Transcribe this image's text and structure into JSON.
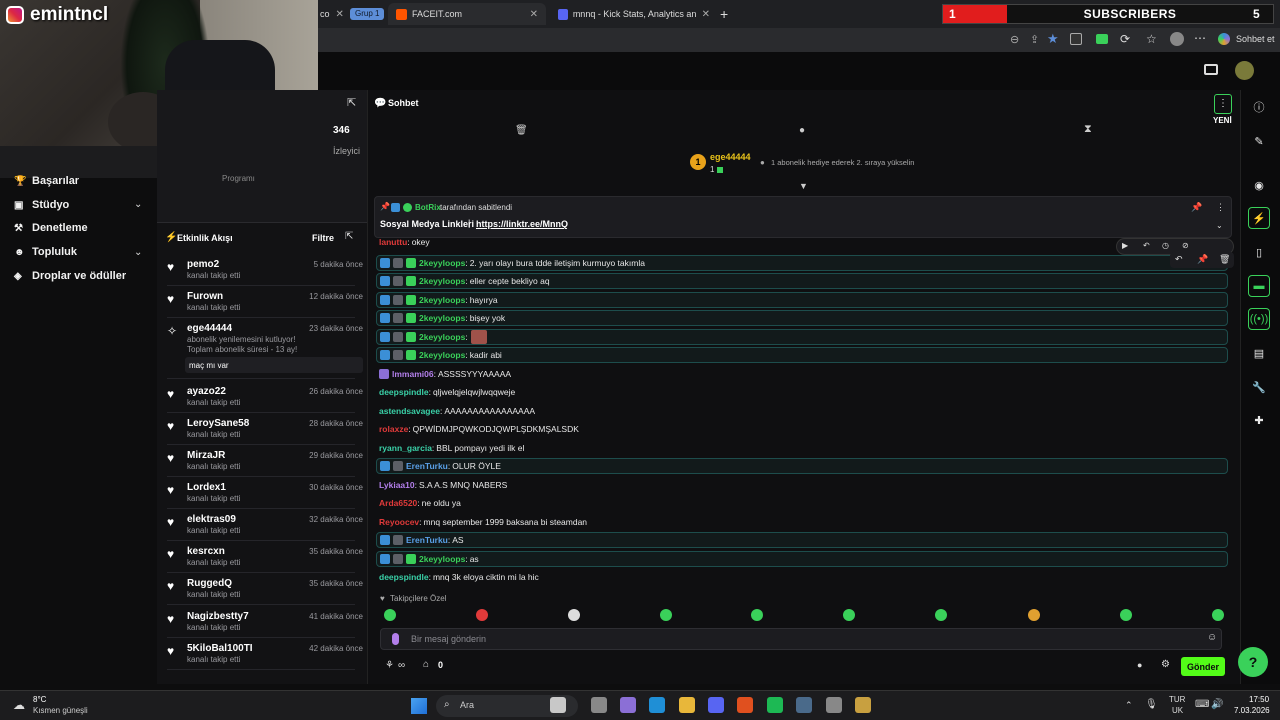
{
  "streamer": {
    "name": "emintncl"
  },
  "subs_bar": {
    "count": "1",
    "label": "SUBSCRIBERS",
    "goal": "5"
  },
  "browser": {
    "tabs": [
      {
        "label": "co",
        "color": "#666"
      },
      {
        "label": "FACEIT.com",
        "color": "#ff5500"
      },
      {
        "label": "mnnq - Kick Stats, Analytics and C",
        "color": "#5865f2"
      }
    ],
    "group_label": "Grup 1",
    "translate_label": "Sohbet et"
  },
  "nav": {
    "items": [
      {
        "label": "Başarılar"
      },
      {
        "label": "Stüdyo"
      },
      {
        "label": "Denetleme"
      },
      {
        "label": "Topluluk"
      },
      {
        "label": "Droplar ve ödüller"
      }
    ],
    "partial_label": "Programı"
  },
  "stats": {
    "viewers": "346",
    "viewers_label": "İzleyici"
  },
  "activity": {
    "title": "Etkinlik Akışı",
    "filter": "Filtre",
    "items": [
      {
        "name": "pemo2",
        "sub": "kanalı takip etti",
        "time": "5 dakika önce",
        "kind": "follow"
      },
      {
        "name": "Furown",
        "sub": "kanalı takip etti",
        "time": "12 dakika önce",
        "kind": "follow"
      },
      {
        "name": "ege44444",
        "sub": "abonelik yenilemesini kutluyor! Toplam abonelik süresi - 13 ay!",
        "time": "23 dakika önce",
        "kind": "sub",
        "message": "maç mı var"
      },
      {
        "name": "ayazo22",
        "sub": "kanalı takip etti",
        "time": "26 dakika önce",
        "kind": "follow"
      },
      {
        "name": "LeroySane58",
        "sub": "kanalı takip etti",
        "time": "28 dakika önce",
        "kind": "follow"
      },
      {
        "name": "MirzaJR",
        "sub": "kanalı takip etti",
        "time": "29 dakika önce",
        "kind": "follow"
      },
      {
        "name": "Lordex1",
        "sub": "kanalı takip etti",
        "time": "30 dakika önce",
        "kind": "follow"
      },
      {
        "name": "elektras09",
        "sub": "kanalı takip etti",
        "time": "32 dakika önce",
        "kind": "follow"
      },
      {
        "name": "kesrcxn",
        "sub": "kanalı takip etti",
        "time": "35 dakika önce",
        "kind": "follow"
      },
      {
        "name": "RuggedQ",
        "sub": "kanalı takip etti",
        "time": "35 dakika önce",
        "kind": "follow"
      },
      {
        "name": "Nagizbestty7",
        "sub": "kanalı takip etti",
        "time": "41 dakika önce",
        "kind": "follow"
      },
      {
        "name": "5KiloBal100TI",
        "sub": "kanalı takip etti",
        "time": "42 dakika önce",
        "kind": "follow"
      }
    ]
  },
  "chat": {
    "title": "Sohbet",
    "new_label": "YENİ",
    "gifter": {
      "rank": "1",
      "name": "ege44444",
      "count": "1",
      "note": "1 abonelik hediye ederek 2. sıraya yükselin"
    },
    "pinned": {
      "by": "BotRix",
      "by_suffix": "tarafından sabitlendi",
      "title": "Sosyal Medya Linkleri",
      "link": "https://linktr.ee/MnnQ"
    },
    "messages": [
      {
        "user": "lanuttu",
        "text": "okey",
        "color": "#e03a3a",
        "hl": false,
        "badges": []
      },
      {
        "user": "2keyyloops",
        "text": "2. yarı olayı bura tdde iletişim kurmuyo takımla",
        "color": "#3ad15a",
        "hl": true,
        "badges": [
          "vip",
          "mod",
          "sub"
        ]
      },
      {
        "user": "2keyyloops",
        "text": "eller cepte bekliyo aq",
        "color": "#3ad15a",
        "hl": true,
        "badges": [
          "vip",
          "mod",
          "sub"
        ]
      },
      {
        "user": "2keyyloops",
        "text": "hayırya",
        "color": "#3ad15a",
        "hl": true,
        "badges": [
          "vip",
          "mod",
          "sub"
        ]
      },
      {
        "user": "2keyyloops",
        "text": "bişey yok",
        "color": "#3ad15a",
        "hl": true,
        "badges": [
          "vip",
          "mod",
          "sub"
        ]
      },
      {
        "user": "2keyyloops",
        "text": "",
        "color": "#3ad15a",
        "hl": true,
        "badges": [
          "vip",
          "mod",
          "sub"
        ],
        "emote": true
      },
      {
        "user": "2keyyloops",
        "text": "kadir abi",
        "color": "#3ad15a",
        "hl": true,
        "badges": [
          "vip",
          "mod",
          "sub"
        ]
      },
      {
        "user": "lmmami06",
        "text": "ASSSSYYYAAAAA",
        "color": "#b37feb",
        "hl": false,
        "badges": [
          "gift"
        ]
      },
      {
        "user": "deepspindle",
        "text": "qljwelqjelqwjlwqqweje",
        "color": "#3ad1a8",
        "hl": false,
        "badges": []
      },
      {
        "user": "astendsavagee",
        "text": "AAAAAAAAAAAAAAAA",
        "color": "#3ad1a8",
        "hl": false,
        "badges": []
      },
      {
        "user": "rolaxze",
        "text": "QPWİDMJPQWKODJQWPLŞDKMŞALSDK",
        "color": "#e03a3a",
        "hl": false,
        "badges": []
      },
      {
        "user": "ryann_garcia",
        "text": "BBL pompayı yedi ilk el",
        "color": "#3ad1a8",
        "hl": false,
        "badges": []
      },
      {
        "user": "ErenTurku",
        "text": "OLUR ÖYLE",
        "color": "#5aa0e8",
        "hl": true,
        "badges": [
          "vip",
          "mod"
        ]
      },
      {
        "user": "Lykiaa10",
        "text": "S.A A.S MNQ NABERS",
        "color": "#b37feb",
        "hl": false,
        "badges": []
      },
      {
        "user": "Arda6520",
        "text": "ne oldu ya",
        "color": "#e03a3a",
        "hl": false,
        "badges": []
      },
      {
        "user": "Reyoocev",
        "text": "mnq september 1999 baksana bi steamdan",
        "color": "#e03a3a",
        "hl": false,
        "badges": []
      },
      {
        "user": "ErenTurku",
        "text": "AS",
        "color": "#5aa0e8",
        "hl": true,
        "badges": [
          "vip",
          "mod"
        ]
      },
      {
        "user": "2keyyloops",
        "text": "as",
        "color": "#3ad15a",
        "hl": true,
        "badges": [
          "vip",
          "mod",
          "sub"
        ]
      },
      {
        "user": "deepspindle",
        "text": "mnq 3k eloya ciktin mi la hic",
        "color": "#3ad1a8",
        "hl": false,
        "badges": []
      }
    ],
    "followers_only": "Takipçilere Özel",
    "input_placeholder": "Bir mesaj gönderin",
    "points": "0",
    "send_label": "Gönder"
  },
  "taskbar": {
    "weather_temp": "8°C",
    "weather_desc": "Kısmen güneşli",
    "search_placeholder": "Ara",
    "lang_top": "TUR",
    "lang_bottom": "UK",
    "time": "17:50",
    "date": "7.03.2026"
  }
}
